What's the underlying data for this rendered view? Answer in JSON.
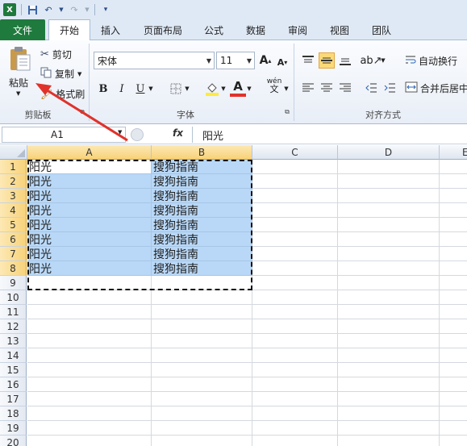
{
  "qat": {
    "app_icon": "X"
  },
  "tabs": [
    "文件",
    "开始",
    "插入",
    "页面布局",
    "公式",
    "数据",
    "审阅",
    "视图",
    "团队"
  ],
  "clipboard": {
    "paste": "粘贴",
    "cut": "剪切",
    "copy": "复制",
    "format_painter": "格式刷",
    "group": "剪贴板"
  },
  "font": {
    "family": "宋体",
    "size": "11",
    "group": "字体",
    "bold": "B",
    "italic": "I",
    "underline": "U",
    "grow": "A",
    "shrink": "A",
    "font_color": "A",
    "phonetic": "wén"
  },
  "alignment": {
    "wrap_text": "自动换行",
    "merge_center": "合并后居中",
    "group": "对齐方式"
  },
  "formula_bar": {
    "name_box": "A1",
    "fx": "fx",
    "content": "阳光"
  },
  "columns": [
    "A",
    "B",
    "C",
    "D",
    "E"
  ],
  "rows": [
    "1",
    "2",
    "3",
    "4",
    "5",
    "6",
    "7",
    "8",
    "9",
    "10",
    "11",
    "12",
    "13",
    "14",
    "15",
    "16",
    "17",
    "18",
    "19",
    "20"
  ],
  "cells": [
    [
      "阳光",
      "搜狗指南"
    ],
    [
      "阳光",
      "搜狗指南"
    ],
    [
      "阳光",
      "搜狗指南"
    ],
    [
      "阳光",
      "搜狗指南"
    ],
    [
      "阳光",
      "搜狗指南"
    ],
    [
      "阳光",
      "搜狗指南"
    ],
    [
      "阳光",
      "搜狗指南"
    ],
    [
      "阳光",
      "搜狗指南"
    ]
  ],
  "colors": {
    "accent_green": "#1f7a3d",
    "selection": "#b9d8f7",
    "header_highlight": "#f7d27a",
    "arrow": "#e0322b"
  }
}
